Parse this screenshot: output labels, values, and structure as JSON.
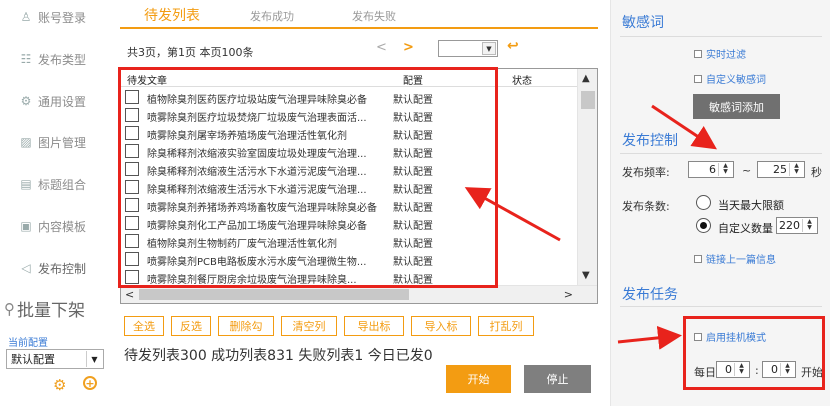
{
  "sidebar": {
    "items": [
      {
        "icon": "person-icon",
        "glyph": "♙",
        "label": "账号登录"
      },
      {
        "icon": "list-icon",
        "glyph": "☷",
        "label": "发布类型"
      },
      {
        "icon": "gear-icon",
        "glyph": "⚙",
        "label": "通用设置"
      },
      {
        "icon": "image-icon",
        "glyph": "▨",
        "label": "图片管理"
      },
      {
        "icon": "tag-icon",
        "glyph": "▤",
        "label": "标题组合"
      },
      {
        "icon": "template-icon",
        "glyph": "▣",
        "label": "内容模板"
      },
      {
        "icon": "send-icon",
        "glyph": "◁",
        "label": "发布控制"
      }
    ],
    "batch_label": "批量下架",
    "current_config_label": "当前配置",
    "current_config_value": "默认配置"
  },
  "tabs": [
    {
      "label": "待发列表",
      "active": true
    },
    {
      "label": "发布成功",
      "active": false
    },
    {
      "label": "发布失败",
      "active": false
    }
  ],
  "pager": {
    "info": "共3页，第1页 本页100条",
    "prev": "<",
    "next": ">",
    "back": "↩"
  },
  "table": {
    "headers": {
      "title": "待发文章",
      "config": "配置",
      "status": "状态"
    },
    "rows": [
      {
        "title": "植物除臭剂医药医疗垃圾站废气治理异味除臭必备",
        "config": "默认配置"
      },
      {
        "title": "喷雾除臭剂医疗垃圾焚烧厂垃圾废气治理表面活...",
        "config": "默认配置"
      },
      {
        "title": "喷雾除臭剂屠宰场养殖场废气治理活性氧化剂",
        "config": "默认配置"
      },
      {
        "title": "除臭稀释剂浓缩液实验室固废垃圾处理废气治理...",
        "config": "默认配置"
      },
      {
        "title": "除臭稀释剂浓缩液生活污水下水道污泥废气治理...",
        "config": "默认配置"
      },
      {
        "title": "除臭稀释剂浓缩液生活污水下水道污泥废气治理...",
        "config": "默认配置"
      },
      {
        "title": "喷雾除臭剂养猪场养鸡场畜牧废气治理异味除臭必备",
        "config": "默认配置"
      },
      {
        "title": "喷雾除臭剂化工产品加工场废气治理异味除臭必备",
        "config": "默认配置"
      },
      {
        "title": "植物除臭剂生物制药厂废气治理活性氧化剂",
        "config": "默认配置"
      },
      {
        "title": "喷雾除臭剂PCB电路板废水污水废气治理微生物...",
        "config": "默认配置"
      },
      {
        "title": "喷雾除臭剂餐厅厨房余垃圾废气治理异味除臭...",
        "config": "默认配置"
      }
    ]
  },
  "actions": [
    "全选",
    "反选",
    "删除勾",
    "清空列",
    "导出标",
    "导入标",
    "打乱列"
  ],
  "stats": "待发列表300  成功列表831  失败列表1  今日已发0",
  "start_label": "开始",
  "stop_label": "停止",
  "right": {
    "sensitive_title": "敏感词",
    "realtime_filter": "实时过滤",
    "custom_sensitive": "自定义敏感词",
    "add_sensitive_btn": "敏感词添加",
    "publish_control_title": "发布控制",
    "freq_label": "发布频率:",
    "freq_min": "6",
    "freq_sep": "~",
    "freq_max": "25",
    "freq_unit": "秒",
    "count_label": "发布条数:",
    "opt_daily_max": "当天最大限额",
    "opt_custom": "自定义数量",
    "custom_count": "220",
    "link_prev": "链接上一篇信息",
    "task_title": "发布任务",
    "enable_hang": "启用挂机模式",
    "daily_label": "每日",
    "hour": "0",
    "colon": ":",
    "minute": "0",
    "start_suffix": "开始"
  },
  "colors": {
    "accent": "#f39c12",
    "blue": "#3a7bd5",
    "annotation": "#e8231c"
  }
}
